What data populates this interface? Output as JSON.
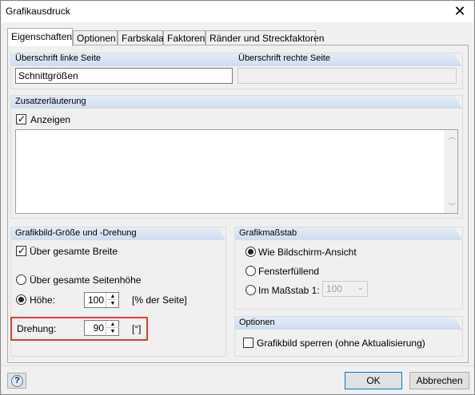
{
  "window": {
    "title": "Grafikausdruck",
    "close_symbol": "✕"
  },
  "tabs": [
    {
      "label": "Eigenschaften",
      "active": true
    },
    {
      "label": "Optionen",
      "active": false
    },
    {
      "label": "Farbskala",
      "active": false
    },
    {
      "label": "Faktoren",
      "active": false
    },
    {
      "label": "Ränder und Streckfaktoren",
      "active": false
    }
  ],
  "headings": {
    "left_title": "Überschrift linke Seite",
    "right_title": "Überschrift rechte Seite"
  },
  "left_title_value": "Schnittgrößen",
  "right_title_value": "",
  "zusatz": {
    "heading": "Zusatzerläuterung",
    "show_label": "Anzeigen",
    "show_checked": true,
    "text": ""
  },
  "size": {
    "heading": "Grafikbild-Größe und -Drehung",
    "full_width_label": "Über gesamte Breite",
    "full_width_checked": true,
    "full_height_label": "Über gesamte Seitenhöhe",
    "height_label": "Höhe:",
    "height_value": "100",
    "height_unit": "[% der Seite]",
    "rotation_label": "Drehung:",
    "rotation_value": "90",
    "rotation_unit": "[°]",
    "selected": "height"
  },
  "scale": {
    "heading": "Grafikmaßstab",
    "screen_label": "Wie Bildschirm-Ansicht",
    "fill_label": "Fensterfüllend",
    "ratio_label": "Im Maßstab 1:",
    "ratio_value": "100",
    "selected": "screen"
  },
  "options": {
    "heading": "Optionen",
    "lock_label": "Grafikbild sperren (ohne Aktualisierung)",
    "lock_checked": false
  },
  "buttons": {
    "ok": "OK",
    "cancel": "Abbrechen",
    "help_symbol": "?"
  },
  "colors": {
    "highlight": "#e53935",
    "group_header": "#cfdcef",
    "default_button_border": "#0078d7"
  }
}
